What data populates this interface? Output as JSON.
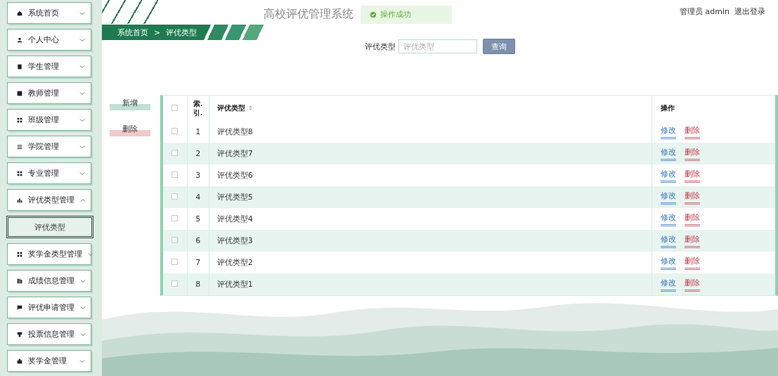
{
  "sidebar": {
    "items": [
      {
        "label": "系统首页",
        "expanded": false
      },
      {
        "label": "个人中心",
        "expanded": false
      },
      {
        "label": "学生管理",
        "expanded": false
      },
      {
        "label": "教师管理",
        "expanded": false
      },
      {
        "label": "班级管理",
        "expanded": false
      },
      {
        "label": "学院管理",
        "expanded": false
      },
      {
        "label": "专业管理",
        "expanded": false
      },
      {
        "label": "评优类型管理",
        "expanded": true,
        "children": [
          {
            "label": "评优类型",
            "selected": true
          }
        ]
      },
      {
        "label": "奖学金类型管理",
        "expanded": false
      },
      {
        "label": "成绩信息管理",
        "expanded": false
      },
      {
        "label": "评优申请管理",
        "expanded": false
      },
      {
        "label": "投票信息管理",
        "expanded": false
      },
      {
        "label": "奖学金管理",
        "expanded": false
      }
    ]
  },
  "header": {
    "title": "高校评优管理系统",
    "user": "管理员 admin",
    "logout": "退出登录"
  },
  "toast": {
    "message": "操作成功"
  },
  "breadcrumb": [
    "系统首页",
    "评优类型"
  ],
  "breadcrumb_separator": ">",
  "search": {
    "label": "评优类型",
    "placeholder": "评优类型",
    "button": "查询"
  },
  "actions": [
    "新增",
    "删除"
  ],
  "table": {
    "select_all": false,
    "columns": [
      "索. 引.",
      "评优类型",
      "操作"
    ],
    "rows": [
      {
        "checked": false,
        "index": "1",
        "name": "评优类型8",
        "edit": "修改",
        "delete": "删除"
      },
      {
        "checked": false,
        "index": "2",
        "name": "评优类型7",
        "edit": "修改",
        "delete": "删除"
      },
      {
        "checked": false,
        "index": "3",
        "name": "评优类型6",
        "edit": "修改",
        "delete": "删除"
      },
      {
        "checked": false,
        "index": "4",
        "name": "评优类型5",
        "edit": "修改",
        "delete": "删除"
      },
      {
        "checked": false,
        "index": "5",
        "name": "评优类型4",
        "edit": "修改",
        "delete": "删除"
      },
      {
        "checked": false,
        "index": "6",
        "name": "评优类型3",
        "edit": "修改",
        "delete": "删除"
      },
      {
        "checked": false,
        "index": "7",
        "name": "评优类型2",
        "edit": "修改",
        "delete": "删除"
      },
      {
        "checked": false,
        "index": "8",
        "name": "评优类型1",
        "edit": "修改",
        "delete": "删除"
      }
    ]
  }
}
